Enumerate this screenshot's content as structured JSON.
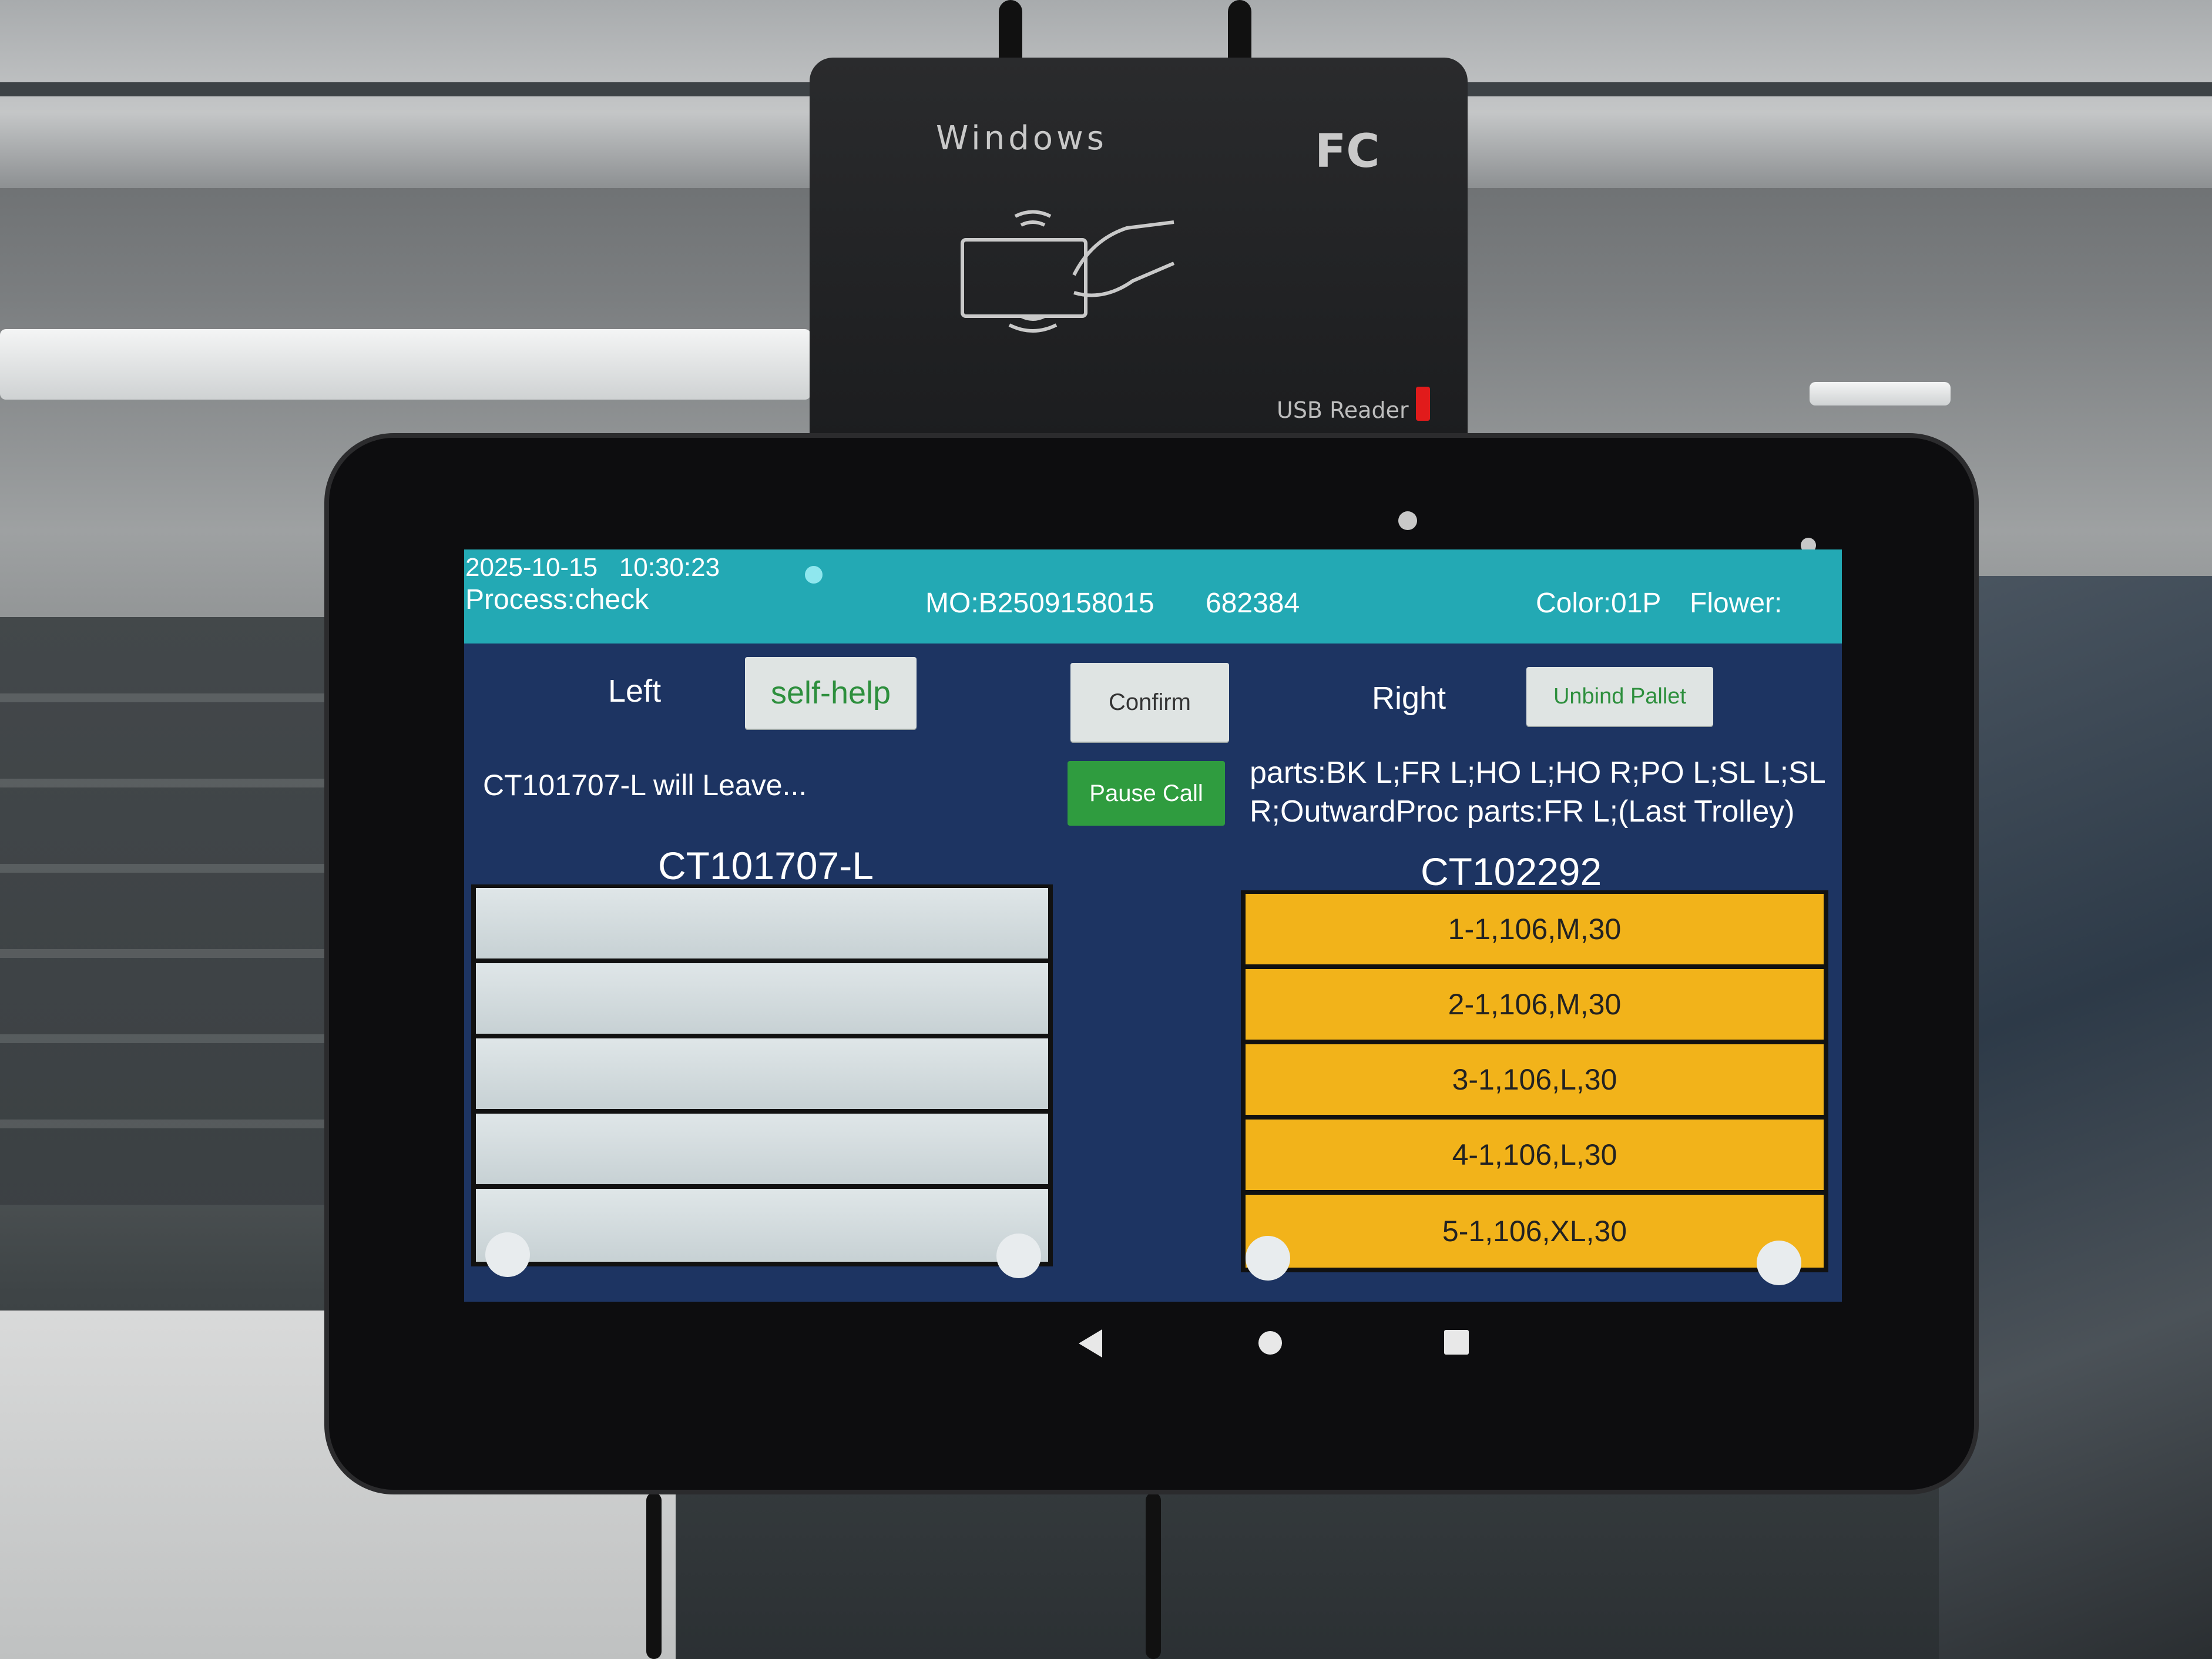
{
  "reader": {
    "brand": "Windows",
    "fcc_mark": "FC",
    "label": "USB Reader"
  },
  "status_bar": {
    "date": "2025-10-15",
    "time": "10:30:23",
    "process": "Process:check",
    "mo": "MO:B2509158015",
    "code": "682384",
    "color": "Color:01P",
    "flower": "Flower:",
    "indicator_color": "#8fe7ee"
  },
  "left": {
    "label": "Left",
    "self_help_button": "self-help",
    "message": "CT101707-L will Leave...",
    "trolley_id": "CT101707-L",
    "slots": [
      "",
      "",
      "",
      "",
      ""
    ]
  },
  "center": {
    "confirm_button": "Confirm",
    "pause_call_button": "Pause Call"
  },
  "right": {
    "label": "Right",
    "unbind_pallet_button": "Unbind Pallet",
    "parts_info": "parts:BK L;FR L;HO L;HO R;PO L;SL L;SL R;OutwardProc parts:FR L;(Last Trolley)",
    "trolley_id": "CT102292",
    "slots": [
      "1-1,106,M,30",
      "2-1,106,M,30",
      "3-1,106,L,30",
      "4-1,106,L,30",
      "5-1,106,XL,30"
    ]
  },
  "colors": {
    "header_bg": "#23a9b4",
    "screen_bg": "#1d3462",
    "filled_slot": "#f2b31a",
    "empty_slot": "#d3dcdf",
    "pause_button": "#2f9c3f"
  },
  "nav_icons": [
    "back-icon",
    "home-icon",
    "recents-icon"
  ]
}
